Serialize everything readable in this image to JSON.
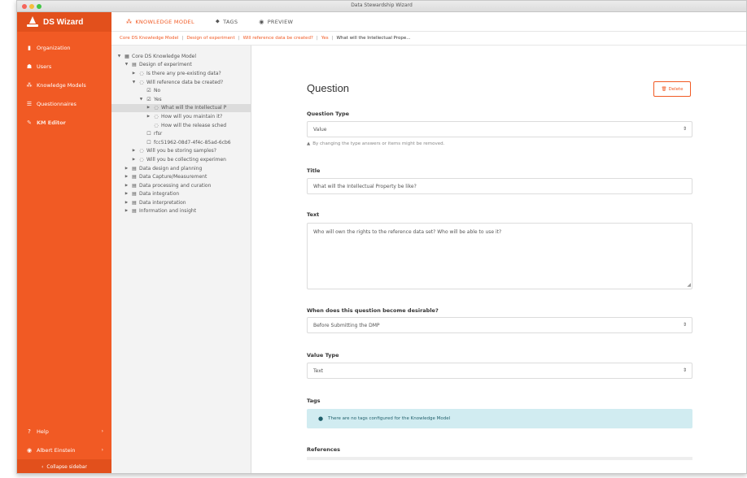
{
  "window": {
    "title": "Data Stewardship Wizard"
  },
  "sidebar": {
    "brand": "DS Wizard",
    "items": [
      {
        "label": "Organization",
        "icon": "building-icon"
      },
      {
        "label": "Users",
        "icon": "users-icon"
      },
      {
        "label": "Knowledge Models",
        "icon": "sitemap-icon"
      },
      {
        "label": "Questionnaires",
        "icon": "list-icon"
      },
      {
        "label": "KM Editor",
        "icon": "edit-icon",
        "active": true
      }
    ],
    "help": "Help",
    "user": "Albert Einstein",
    "collapse": "Collapse sidebar"
  },
  "topbar": {
    "tabs": [
      {
        "label": "KNOWLEDGE MODEL",
        "icon": "sitemap-icon",
        "active": true
      },
      {
        "label": "TAGS",
        "icon": "tag-icon"
      },
      {
        "label": "PREVIEW",
        "icon": "eye-icon"
      }
    ]
  },
  "breadcrumb": [
    "Core DS Knowledge Model",
    "Design of experiment",
    "Will reference data be created?",
    "Yes",
    "What will the Intellectual Prope..."
  ],
  "tree": [
    {
      "label": "Core DS Knowledge Model",
      "indent": 0,
      "toggle": "down",
      "icon": "km"
    },
    {
      "label": "Design of experiment",
      "indent": 1,
      "toggle": "down",
      "icon": "chapter"
    },
    {
      "label": "Is there any pre-existing data?",
      "indent": 2,
      "toggle": "right",
      "icon": "question"
    },
    {
      "label": "Will reference data be created?",
      "indent": 2,
      "toggle": "down",
      "icon": "question"
    },
    {
      "label": "No",
      "indent": 3,
      "toggle": "",
      "icon": "answer"
    },
    {
      "label": "Yes",
      "indent": 3,
      "toggle": "down",
      "icon": "answer"
    },
    {
      "label": "What will the Intellectual P",
      "indent": 4,
      "toggle": "right",
      "icon": "question",
      "selected": true
    },
    {
      "label": "How will you maintain it?",
      "indent": 4,
      "toggle": "right",
      "icon": "question"
    },
    {
      "label": "How will the release sched",
      "indent": 4,
      "toggle": "",
      "icon": "question"
    },
    {
      "label": "rfsr",
      "indent": 3,
      "toggle": "",
      "icon": "item"
    },
    {
      "label": "fcc51962-08d7-4f4c-85ad-6cb6",
      "indent": 3,
      "toggle": "",
      "icon": "item"
    },
    {
      "label": "Will you be storing samples?",
      "indent": 2,
      "toggle": "right",
      "icon": "question"
    },
    {
      "label": "Will you be collecting experimen",
      "indent": 2,
      "toggle": "right",
      "icon": "question"
    },
    {
      "label": "Data design and planning",
      "indent": 1,
      "toggle": "right",
      "icon": "chapter"
    },
    {
      "label": "Data Capture/Measurement",
      "indent": 1,
      "toggle": "right",
      "icon": "chapter"
    },
    {
      "label": "Data processing and curation",
      "indent": 1,
      "toggle": "right",
      "icon": "chapter"
    },
    {
      "label": "Data integration",
      "indent": 1,
      "toggle": "right",
      "icon": "chapter"
    },
    {
      "label": "Data interpretation",
      "indent": 1,
      "toggle": "right",
      "icon": "chapter"
    },
    {
      "label": "Information and insight",
      "indent": 1,
      "toggle": "right",
      "icon": "chapter"
    }
  ],
  "editor": {
    "heading": "Question",
    "delete_label": "Delete",
    "question_type": {
      "label": "Question Type",
      "value": "Value",
      "hint": "By changing the type answers or items might be removed."
    },
    "title": {
      "label": "Title",
      "value": "What will the Intellectual Property be like?"
    },
    "text": {
      "label": "Text",
      "value": "Who will own the rights to the reference data set? Who will be able to use it?"
    },
    "desirable": {
      "label": "When does this question become desirable?",
      "value": "Before Submitting the DMP"
    },
    "value_type": {
      "label": "Value Type",
      "value": "Text"
    },
    "tags": {
      "label": "Tags",
      "alert": "There are no tags configured for the Knowledge Model"
    },
    "references": {
      "label": "References"
    }
  },
  "colors": {
    "brand": "#f15a24",
    "brand_dark": "#e2501c",
    "info_bg": "#d1ecf1"
  }
}
